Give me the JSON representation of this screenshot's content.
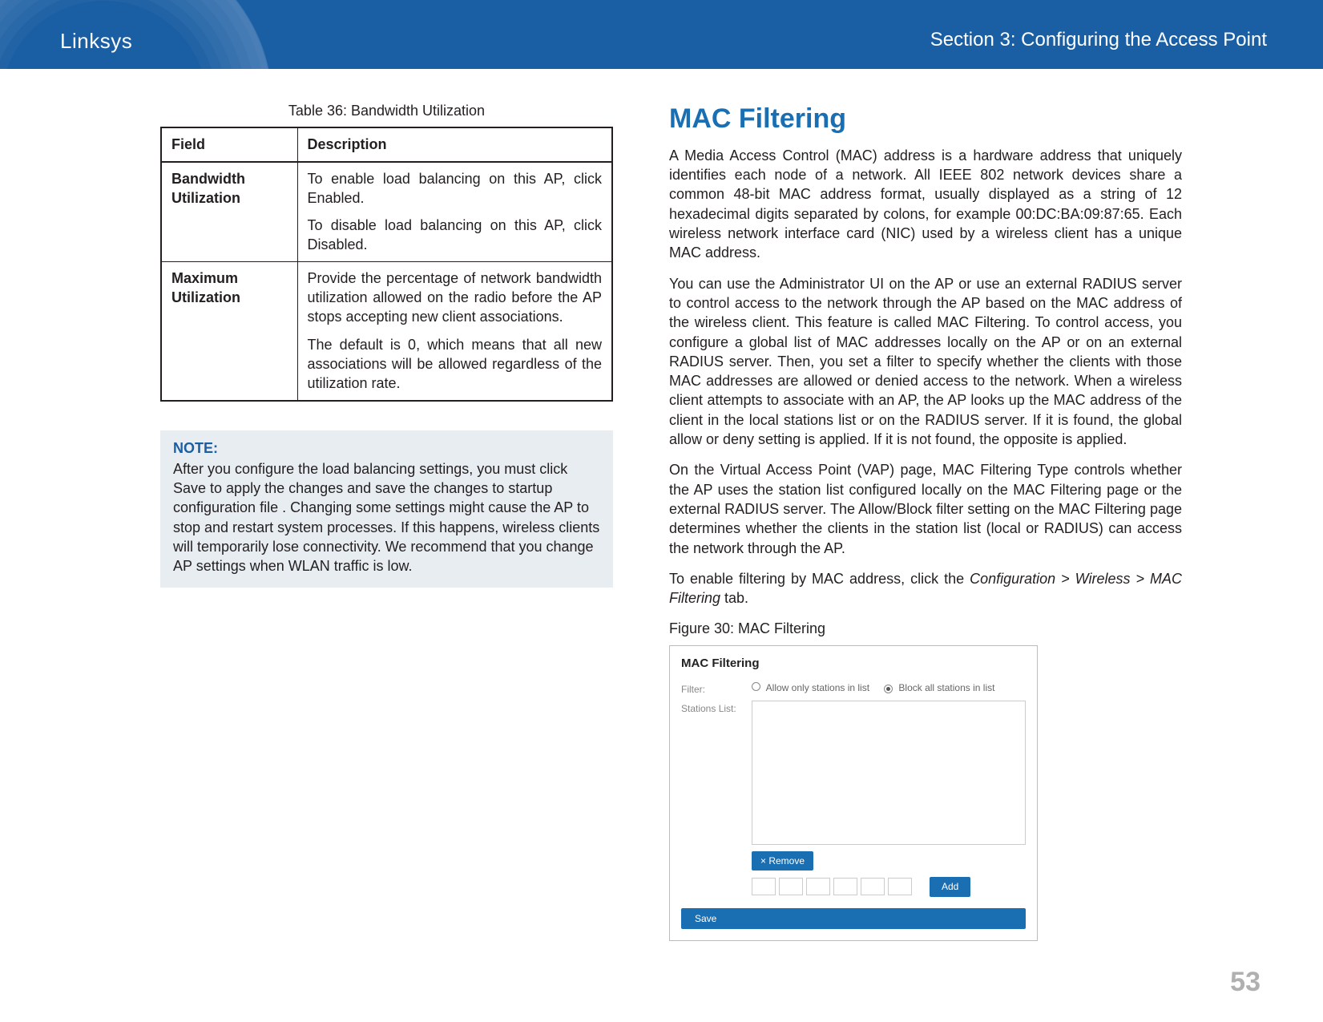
{
  "header": {
    "brand": "Linksys",
    "section": "Section 3:  Configuring the Access Point"
  },
  "left": {
    "table_caption": "Table 36: Bandwidth Utilization",
    "table": {
      "head_field": "Field",
      "head_desc": "Description",
      "rows": [
        {
          "field": "Bandwidth Utilization",
          "desc": [
            "To enable load balancing on this AP, click Enabled.",
            "To disable load balancing on this AP, click Disabled."
          ]
        },
        {
          "field": "Maximum Utilization",
          "desc": [
            "Provide the percentage of network bandwidth utilization allowed on the radio before the AP stops accepting new client associations.",
            "The default is 0, which means that all new associations will be allowed regardless of the utilization rate."
          ]
        }
      ]
    },
    "note": {
      "title": "NOTE:",
      "body": "After you configure the load balancing settings, you must click Save to apply the changes and save the changes to startup configuration file . Changing some settings might cause the AP to stop and restart system processes. If this happens, wireless clients will temporarily lose connectivity. We recommend that you change AP settings when WLAN traffic is low."
    }
  },
  "right": {
    "heading": "MAC Filtering",
    "paragraphs": [
      "A Media Access Control (MAC) address is a hardware address that uniquely identifies each node of a network. All IEEE 802 network devices share a common 48-bit MAC address format, usually displayed as a string of 12 hexadecimal digits separated by colons, for example 00:DC:BA:09:87:65. Each wireless network interface card (NIC) used by a wireless client has a unique MAC address.",
      "You can use the Administrator UI on the AP or use an external RADIUS server to control access to the network through the AP based on the MAC address of the wireless client. This feature is called MAC Filtering. To control access, you configure a global list of MAC addresses locally on the AP or on an external RADIUS server. Then, you set a filter to specify whether the clients with those MAC addresses are allowed or denied access to the network. When a wireless client attempts to associate with an AP, the AP looks up the MAC address of the client in the local stations list or on the RADIUS server. If it is found, the global allow or deny setting is applied. If it is not found, the opposite is applied.",
      "On the Virtual Access Point (VAP) page, MAC Filtering Type controls whether the AP uses the station list configured locally on the MAC Filtering page or the external RADIUS server. The Allow/Block filter setting on the MAC Filtering page determines whether the clients in the station list (local or RADIUS) can access the network through the AP."
    ],
    "enable_sentence_prefix": "To enable filtering by MAC address, click the ",
    "enable_sentence_path": "Configuration > Wireless > MAC Filtering",
    "enable_sentence_suffix": " tab.",
    "figure_caption": "Figure 30: MAC Filtering",
    "figure": {
      "panel_title": "MAC Filtering",
      "filter_label": "Filter:",
      "radio_allow": "Allow only stations in list",
      "radio_block": "Block all stations in list",
      "stations_label": "Stations List:",
      "remove_label": "Remove",
      "add_label": "Add",
      "save_label": "Save"
    }
  },
  "page_number": "53"
}
